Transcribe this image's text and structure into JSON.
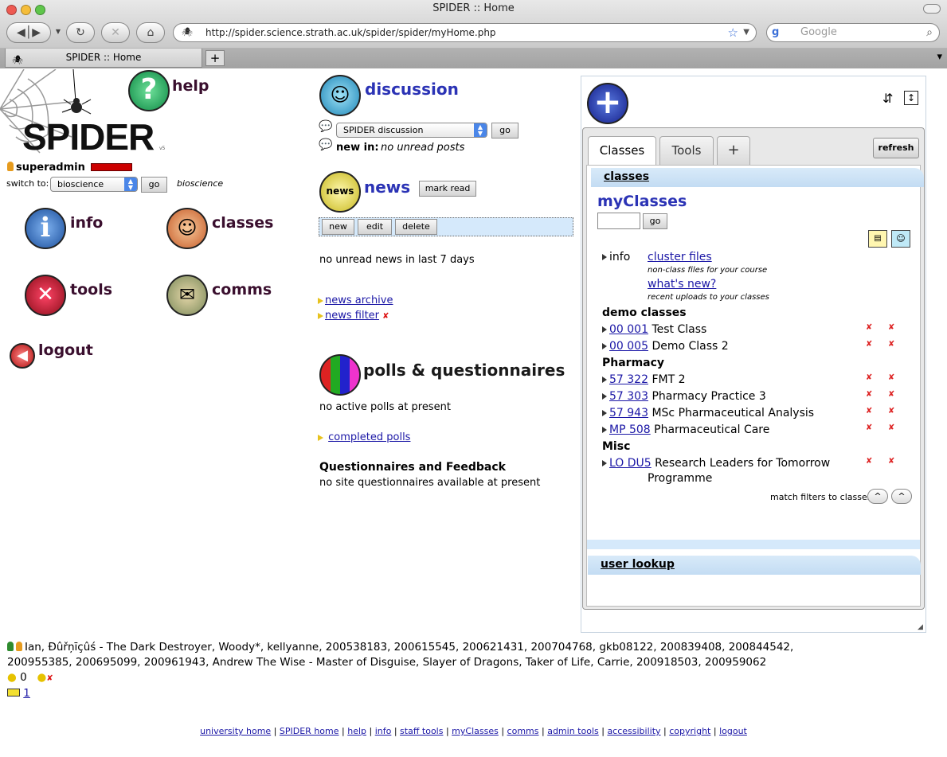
{
  "window": {
    "title": "SPIDER :: Home"
  },
  "browser": {
    "url": "http://spider.science.strath.ac.uk/spider/spider/myHome.php",
    "search_placeholder": "Google",
    "search_engine_letter": "g",
    "tab_title": "SPIDER :: Home",
    "new_tab": "+"
  },
  "logo": {
    "text": "SPIDER",
    "version": "v5"
  },
  "user": {
    "name": "superadmin",
    "switch_label": "switch to:",
    "switch_value": "bioscience",
    "switch_go": "go",
    "current": "bioscience"
  },
  "nav": {
    "help": "help",
    "info": "info",
    "classes": "classes",
    "tools": "tools",
    "comms": "comms",
    "logout": "logout"
  },
  "discussion": {
    "title": "discussion",
    "select_value": "SPIDER discussion",
    "go": "go",
    "new_in_label": "new in:",
    "new_in_value": "no unread posts"
  },
  "news": {
    "title": "news",
    "mark_read": "mark read",
    "buttons": {
      "new": "new",
      "edit": "edit",
      "delete": "delete"
    },
    "status": "no unread news in last 7 days",
    "archive": "news archive",
    "filter": "news filter"
  },
  "polls": {
    "title": "polls & questionnaires",
    "status": "no active polls at present",
    "completed": "completed polls",
    "q_heading": "Questionnaires and Feedback",
    "q_status": "no site questionnaires available at present"
  },
  "widget": {
    "tabs": {
      "classes": "Classes",
      "tools": "Tools",
      "add": "+"
    },
    "refresh": "refresh",
    "classes_bar": "classes",
    "myclasses_title": "myClasses",
    "go": "go",
    "info_label": "info",
    "cluster_files": "cluster files",
    "cluster_desc": "non-class files for your course",
    "whats_new": "what's new?",
    "whats_new_desc": "recent uploads to your classes",
    "groups": {
      "demo": "demo classes",
      "pharmacy": "Pharmacy",
      "misc": "Misc"
    },
    "classes": [
      {
        "code": "00 001",
        "name": "Test Class"
      },
      {
        "code": "00 005",
        "name": "Demo Class 2"
      },
      {
        "code": "57 322",
        "name": "FMT 2"
      },
      {
        "code": "57 303",
        "name": "Pharmacy Practice 3"
      },
      {
        "code": "57 943",
        "name": "MSc Pharmaceutical Analysis"
      },
      {
        "code": "MP 508",
        "name": "Pharmaceutical Care"
      },
      {
        "code": "LO DU5",
        "name": "Research Leaders for Tomorrow",
        "name2": "Programme"
      }
    ],
    "match_filters": "match filters to classes",
    "user_lookup": "user lookup"
  },
  "online": {
    "line1": "Ian, Đûřņīçûś - The Dark Destroyer, Woody*, kellyanne, 200538183, 200615545, 200621431, 200704768, gkb08122, 200839408, 200844542,",
    "line2": "200955385, 200695099, 200961943, Andrew The Wise - Master of Disguise, Slayer of Dragons, Taker of Life, Carrie, 200918503, 200959062",
    "pac_count": "0",
    "msg_count": "1"
  },
  "footer": {
    "links": [
      "university home",
      "SPIDER home",
      "help",
      "info",
      "staff tools",
      "myClasses",
      "comms",
      "admin tools",
      "accessibility",
      "copyright",
      "logout"
    ]
  },
  "colors": {
    "accent": "#2b33b5",
    "nav_text": "#3a0f2e",
    "link": "#1b17a6",
    "bar": "#c3dcf3"
  }
}
